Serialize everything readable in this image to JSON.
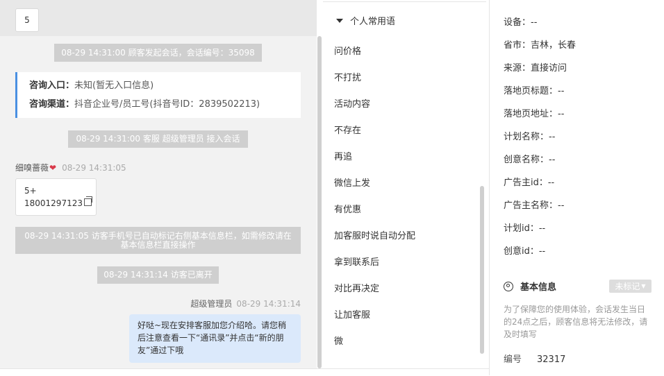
{
  "chat": {
    "top_number": "5",
    "sys_session": "08-29 14:31:00 顾客发起会话，会话编号：35098",
    "card": {
      "entry_label": "咨询入口：",
      "entry_value": "未知(暂无入口信息)",
      "channel_label": "咨询渠道：",
      "channel_value": "抖音企业号/员工号(抖音号ID：2839502213)"
    },
    "sys_join": "08-29 14:31:00 客服 超级管理员 接入会话",
    "visitor_name": "细嗅蔷薇",
    "visitor_time": "08-29 14:31:05",
    "visitor_msg_line1": "5+",
    "visitor_msg_line2": "18001297123",
    "sys_phone": "08-29 14:31:05 访客手机号已自动标记右侧基本信息栏，如需修改请在基本信息栏直接操作",
    "sys_left": "08-29 14:31:14 访客已离开",
    "agent_name": "超级管理员",
    "agent_time": "08-29 14:31:14",
    "agent_msg": "好哒~现在安排客服加您介绍哈。请您稍后注意查看一下“通讯录”并点击“新的朋友”通过下哦"
  },
  "phrases": {
    "header": "个人常用语",
    "items": [
      "问价格",
      "不打扰",
      "活动内容",
      "不存在",
      "再追",
      "微信上发",
      "有优惠",
      "加客服时说自动分配",
      "拿到联系后",
      "对比再决定",
      "让加客服",
      "微"
    ]
  },
  "panel": {
    "fields": [
      "设备：--",
      "省市：吉林，长春",
      "来源：直接访问",
      "落地页标题：--",
      "落地页地址：--",
      "计划名称：--",
      "创意名称：--",
      "广告主id：--",
      "广告主名称：--",
      "计划id：--",
      "创意id：--"
    ],
    "basic_info_title": "基本信息",
    "tag_button": "未标记",
    "hint": "为了保障您的使用体验，会话发生当日的24点之后，顾客信息将无法修改，请及时填写",
    "id_label": "编号",
    "id_value": "32317"
  }
}
